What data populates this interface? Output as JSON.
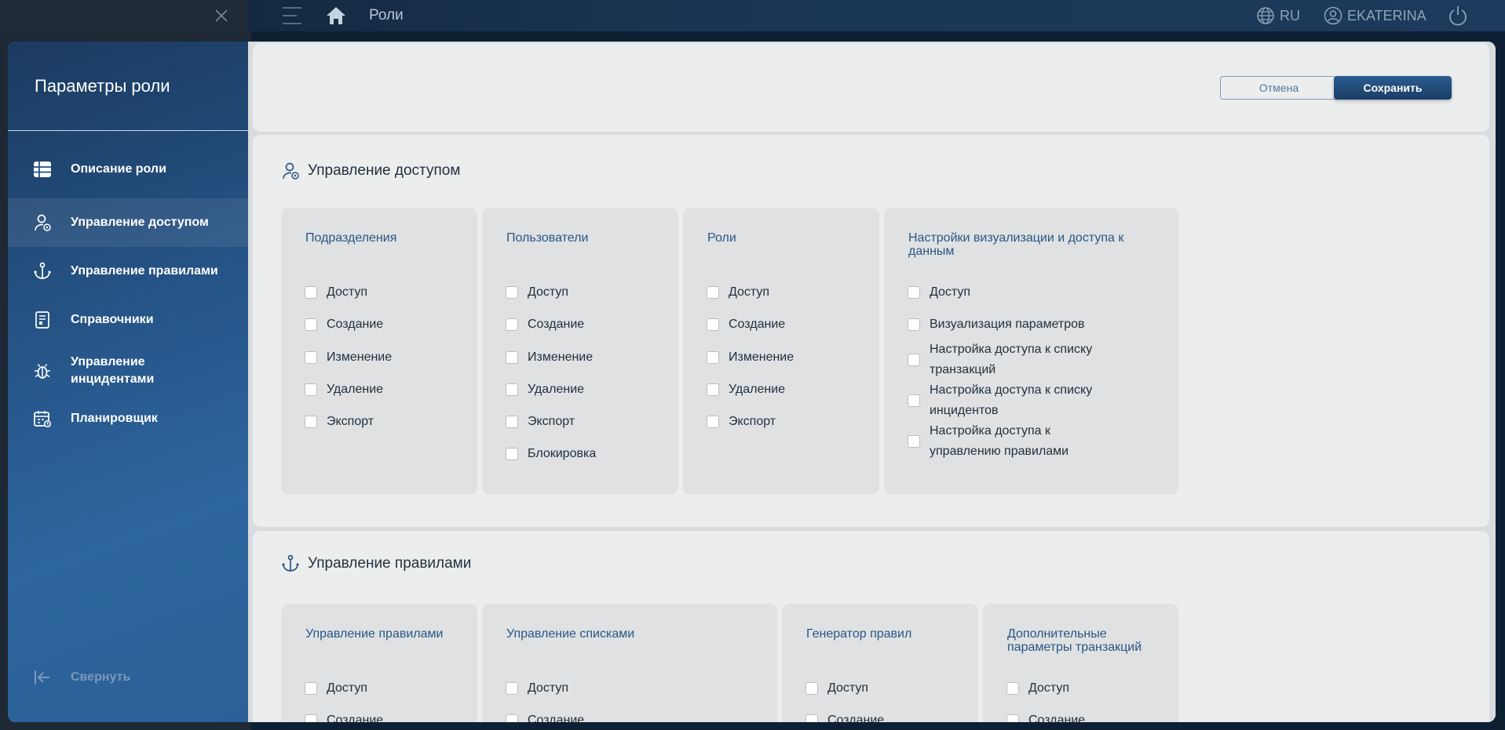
{
  "topbar": {
    "title": "Роли",
    "lang": "RU",
    "user": "EKATERINA"
  },
  "sidebar": {
    "title": "Параметры роли",
    "items": [
      {
        "label": "Описание роли",
        "icon": "table-icon"
      },
      {
        "label": "Управление доступом",
        "icon": "user-lock-icon"
      },
      {
        "label": "Управление правилами",
        "icon": "anchor-icon"
      },
      {
        "label": "Справочники",
        "icon": "book-icon"
      },
      {
        "label": "Управление инцидентами",
        "icon": "bug-icon"
      },
      {
        "label": "Планировщик",
        "icon": "calendar-icon"
      }
    ],
    "collapse_label": "Свернуть"
  },
  "actions": {
    "cancel_label": "Отмена",
    "save_label": "Сохранить"
  },
  "access_section": {
    "title": "Управление доступом",
    "groups": [
      {
        "title": "Подразделения",
        "options": [
          "Доступ",
          "Создание",
          "Изменение",
          "Удаление",
          "Экспорт"
        ]
      },
      {
        "title": "Пользователи",
        "options": [
          "Доступ",
          "Создание",
          "Изменение",
          "Удаление",
          "Экспорт",
          "Блокировка"
        ]
      },
      {
        "title": "Роли",
        "options": [
          "Доступ",
          "Создание",
          "Изменение",
          "Удаление",
          "Экспорт"
        ]
      },
      {
        "title": "Настройки визуализации и доступа к данным",
        "options": [
          "Доступ",
          "Визуализация параметров",
          "Настройка доступа к списку транзакций",
          "Настройка доступа к списку инцидентов",
          "Настройка доступа к управлению правилами"
        ]
      }
    ]
  },
  "rules_section": {
    "title": "Управление правилами",
    "groups": [
      {
        "title": "Управление правилами",
        "options": [
          "Доступ",
          "Создание"
        ]
      },
      {
        "title": "Управление списками",
        "options": [
          "Доступ",
          "Создание"
        ]
      },
      {
        "title": "Генератор правил",
        "options": [
          "Доступ",
          "Создание"
        ]
      },
      {
        "title": "Дополнительные параметры транзакций",
        "options": [
          "Доступ",
          "Создание"
        ]
      }
    ]
  },
  "colors": {
    "accent": "#2a5686",
    "sidebar_top": "#1b3a60",
    "sidebar_bottom": "#2d659e"
  }
}
